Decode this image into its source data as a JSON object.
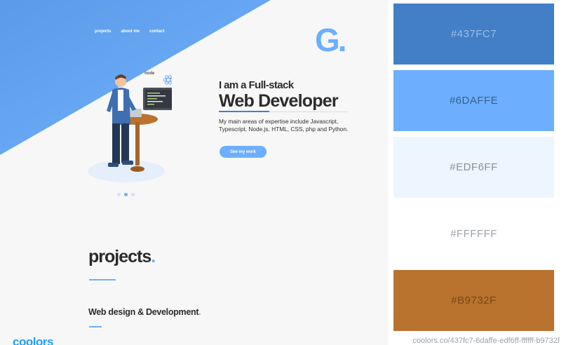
{
  "site": {
    "nav": [
      "projects",
      "about me",
      "contact"
    ],
    "logo": "G.",
    "hero": {
      "kicker": "I am a Full-stack",
      "title": "Web Developer",
      "description": "My main areas of expertise include Javascript, Typescript, Node.js, HTML, CSS, php and Python.",
      "button": "See my work"
    },
    "carousel": {
      "count": 3,
      "active_index": 1
    },
    "projects": {
      "title": "projects",
      "accent": ".",
      "subtitle": "Web design & Development",
      "subtitle_accent": "."
    },
    "illustration_label": "node"
  },
  "palette": [
    {
      "hex": "#437FC7",
      "bg": "#437FC7",
      "fg": "#9cbde3"
    },
    {
      "hex": "#6DAFFE",
      "bg": "#6DAFFE",
      "fg": "#37608e"
    },
    {
      "hex": "#EDF6FF",
      "bg": "#EDF6FF",
      "fg": "#8a8f96"
    },
    {
      "hex": "#FFFFFF",
      "bg": "#FFFFFF",
      "fg": "#9aa0a6"
    },
    {
      "hex": "#B9732F",
      "bg": "#B9732F",
      "fg": "#7a4513"
    }
  ],
  "brand": "coolors",
  "footer_url": "coolors.co/437fc7-6daffe-edf6ff-ffffff-b9732f",
  "colors": {
    "accent": "#437FC7",
    "light_blue": "#6DAFFE",
    "text": "#2b2b2b"
  }
}
